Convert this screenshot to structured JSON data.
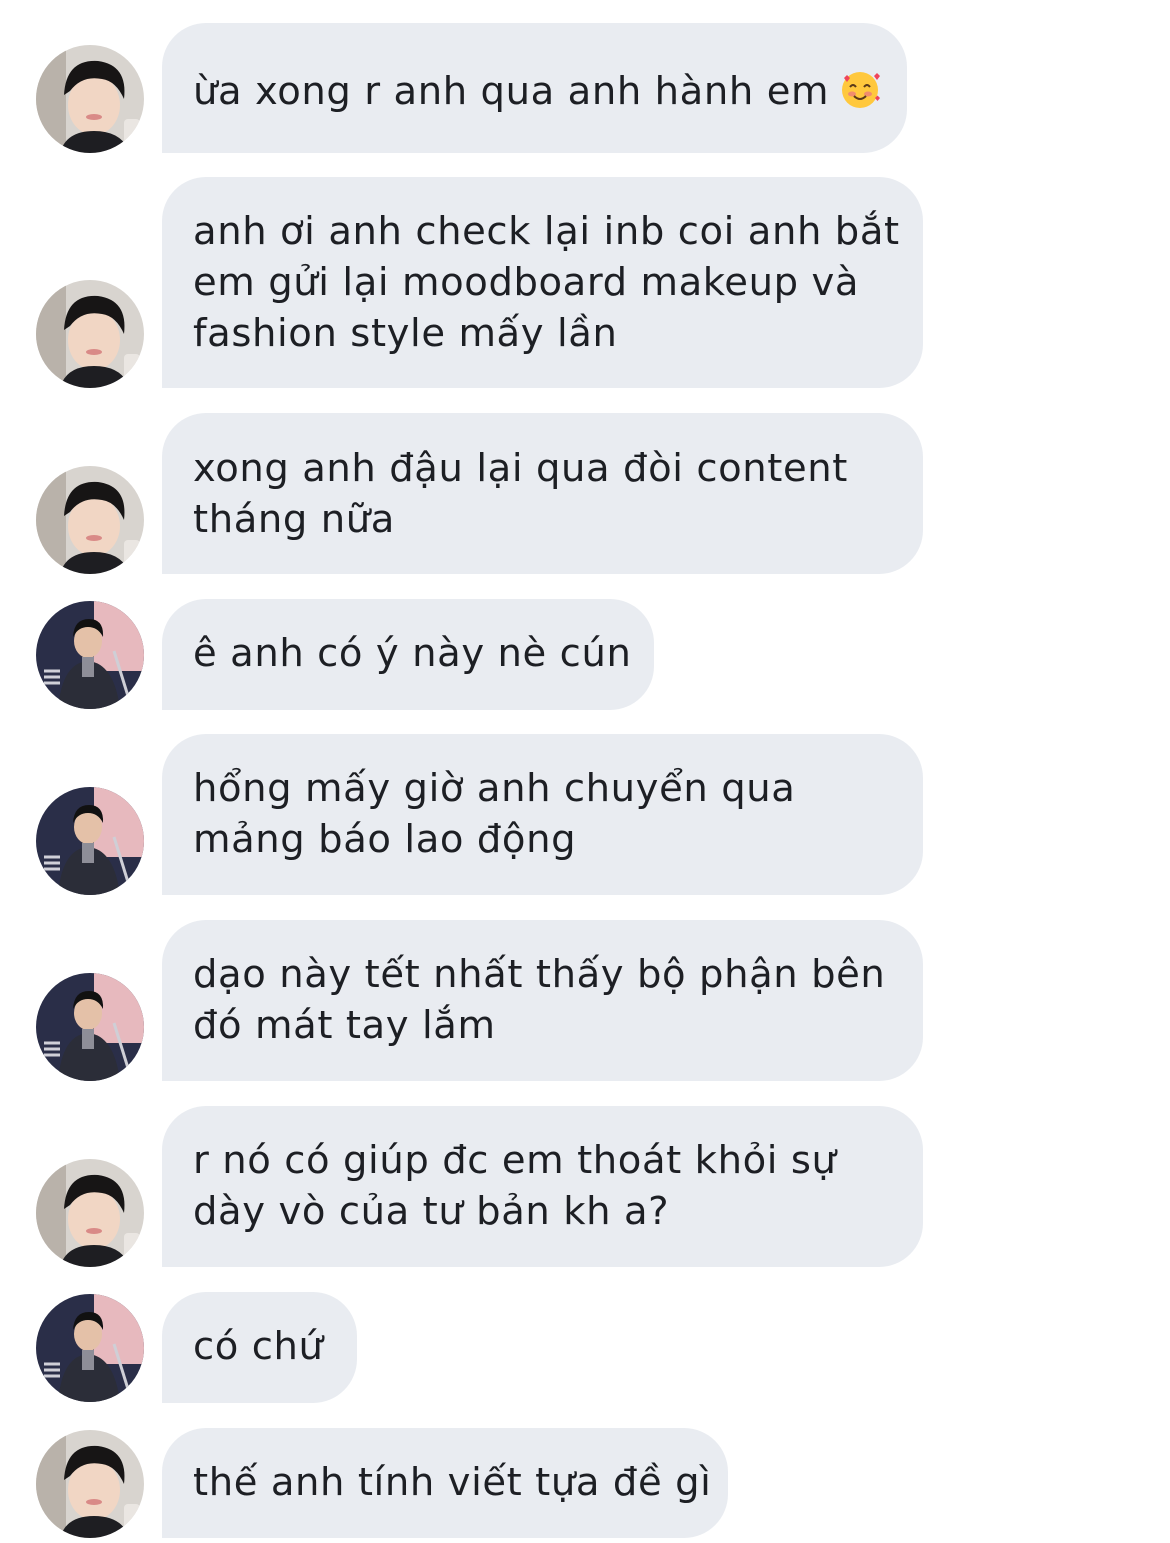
{
  "messages": [
    {
      "sender": "a",
      "text": "ừa xong r anh qua anh hành em",
      "lines": [
        "ừa xong r anh qua anh hành em"
      ],
      "emoji": "smiling-face-with-hearts-icon"
    },
    {
      "sender": "a",
      "lines": [
        "anh ơi anh check lại inb coi anh bắt",
        "em gửi lại moodboard makeup và",
        "fashion style mấy lần"
      ]
    },
    {
      "sender": "a",
      "lines": [
        "xong anh đậu lại qua đòi content",
        "tháng nữa"
      ]
    },
    {
      "sender": "b",
      "lines": [
        "ê anh có ý này nè cún"
      ]
    },
    {
      "sender": "b",
      "lines": [
        "hổng mấy giờ anh chuyển qua",
        "mảng báo lao động"
      ]
    },
    {
      "sender": "b",
      "lines": [
        "dạo này tết nhất thấy bộ phận bên",
        "đó mát tay lắm"
      ]
    },
    {
      "sender": "a",
      "lines": [
        "r nó có giúp đc em thoát khỏi sự",
        "dày vò của tư bản kh a?"
      ]
    },
    {
      "sender": "b",
      "lines": [
        "có chứ"
      ]
    },
    {
      "sender": "a",
      "lines": [
        "thế anh tính viết tựa đề gì"
      ]
    }
  ],
  "colors": {
    "bubble": "#e9ecf1",
    "text": "#1d1f24",
    "background": "#ffffff"
  }
}
